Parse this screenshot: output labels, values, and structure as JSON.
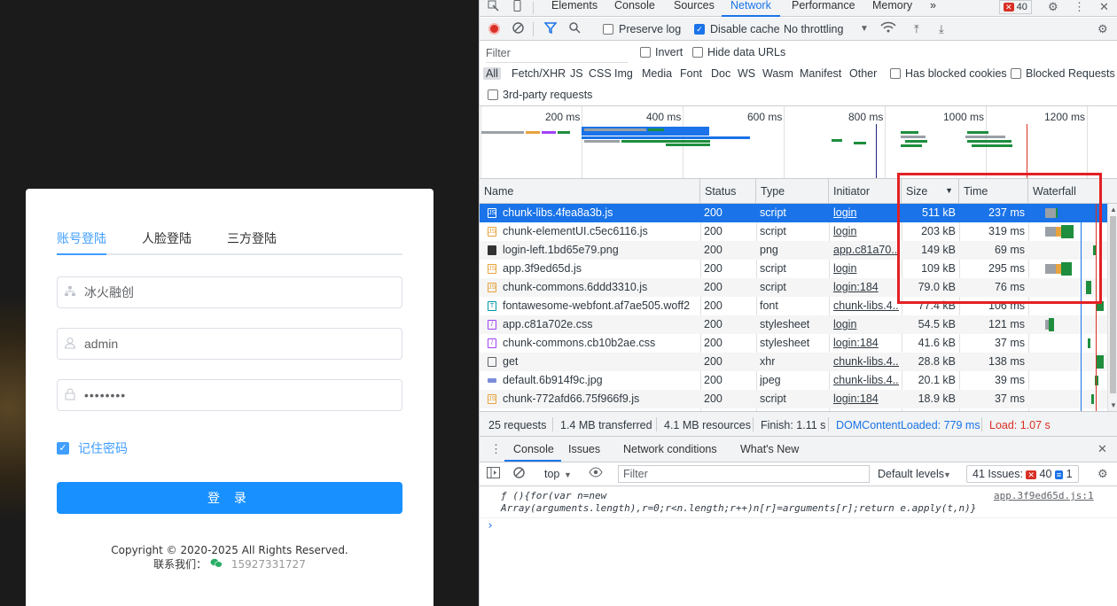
{
  "login": {
    "tabs": [
      "账号登陆",
      "人脸登陆",
      "三方登陆"
    ],
    "org_value": "冰火融创",
    "username_value": "admin",
    "password_mask": "••••••••",
    "remember_label": "记住密码",
    "login_button": "登 录",
    "copyright": "Copyright © 2020-2025 All Rights Reserved.",
    "contact_label": "联系我们：",
    "contact_phone": "15927331727"
  },
  "devtools": {
    "main_tabs": [
      "Elements",
      "Console",
      "Sources",
      "Network",
      "Performance",
      "Memory"
    ],
    "active_tab": "Network",
    "more_tabs": "»",
    "error_count": "40",
    "toolbar": {
      "preserve_log": "Preserve log",
      "disable_cache": "Disable cache",
      "throttling": "No throttling"
    },
    "filter_placeholder": "Filter",
    "invert": "Invert",
    "hide_data_urls": "Hide data URLs",
    "type_filters": [
      "All",
      "Fetch/XHR",
      "JS",
      "CSS",
      "Img",
      "Media",
      "Font",
      "Doc",
      "WS",
      "Wasm",
      "Manifest",
      "Other"
    ],
    "has_blocked_cookies": "Has blocked cookies",
    "blocked_requests": "Blocked Requests",
    "third_party": "3rd-party requests",
    "overview_ticks": [
      "200 ms",
      "400 ms",
      "600 ms",
      "800 ms",
      "1000 ms",
      "1200 ms"
    ],
    "columns": [
      "Name",
      "Status",
      "Type",
      "Initiator",
      "Size",
      "Time",
      "Waterfall"
    ],
    "sort_indicator": "▼",
    "rows": [
      {
        "name": "chunk-libs.4fea8a3b.js",
        "status": "200",
        "type": "script",
        "initiator": "login",
        "size": "511 kB",
        "time": "237 ms"
      },
      {
        "name": "chunk-elementUI.c5ec6116.js",
        "status": "200",
        "type": "script",
        "initiator": "login",
        "size": "203 kB",
        "time": "319 ms"
      },
      {
        "name": "login-left.1bd65e79.png",
        "status": "200",
        "type": "png",
        "initiator": "app.c81a70...",
        "size": "149 kB",
        "time": "69 ms"
      },
      {
        "name": "app.3f9ed65d.js",
        "status": "200",
        "type": "script",
        "initiator": "login",
        "size": "109 kB",
        "time": "295 ms"
      },
      {
        "name": "chunk-commons.6ddd3310.js",
        "status": "200",
        "type": "script",
        "initiator": "login:184",
        "size": "79.0 kB",
        "time": "76 ms"
      },
      {
        "name": "fontawesome-webfont.af7ae505.woff2",
        "status": "200",
        "type": "font",
        "initiator": "chunk-libs.4...",
        "size": "77.4 kB",
        "time": "106 ms"
      },
      {
        "name": "app.c81a702e.css",
        "status": "200",
        "type": "stylesheet",
        "initiator": "login",
        "size": "54.5 kB",
        "time": "121 ms"
      },
      {
        "name": "chunk-commons.cb10b2ae.css",
        "status": "200",
        "type": "stylesheet",
        "initiator": "login:184",
        "size": "41.6 kB",
        "time": "37 ms"
      },
      {
        "name": "get",
        "status": "200",
        "type": "xhr",
        "initiator": "chunk-libs.4...",
        "size": "28.8 kB",
        "time": "138 ms"
      },
      {
        "name": "default.6b914f9c.jpg",
        "status": "200",
        "type": "jpeg",
        "initiator": "chunk-libs.4...",
        "size": "20.1 kB",
        "time": "39 ms"
      },
      {
        "name": "chunk-772afd66.75f966f9.js",
        "status": "200",
        "type": "script",
        "initiator": "login:184",
        "size": "18.9 kB",
        "time": "37 ms"
      }
    ],
    "summary": {
      "requests": "25 requests",
      "transferred": "1.4 MB transferred",
      "resources": "4.1 MB resources",
      "finish": "Finish: 1.11 s",
      "dcl": "DOMContentLoaded: 779 ms",
      "load": "Load: 1.07 s"
    },
    "drawer_tabs": [
      "Console",
      "Issues",
      "Network conditions",
      "What's New"
    ],
    "console": {
      "context": "top",
      "filter_placeholder": "Filter",
      "levels": "Default levels",
      "issues_label": "41 Issues:",
      "issues_errors": "40",
      "issues_info": "1",
      "line1": "ƒ (){for(var n=new",
      "line2": "Array(arguments.length),r=0;r<n.length;r++)n[r]=arguments[r];return e.apply(t,n)}",
      "source": "app.3f9ed65d.js:1",
      "prompt": "›"
    }
  }
}
